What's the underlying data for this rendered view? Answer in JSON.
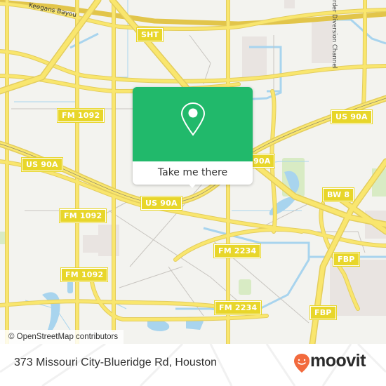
{
  "map": {
    "attribution": "© OpenStreetMap contributors",
    "labels": {
      "keegans_bayou": "Keegans Bayou",
      "diversion_channel": "rder Diversion Channel"
    },
    "shields": {
      "sht": "SHT",
      "fm1092_a": "FM 1092",
      "us90a_a": "US 90A",
      "us90a_b": "US 90A",
      "us90a_c": "US 90A",
      "us90a_d": "90A",
      "bw8": "BW 8",
      "fm1092_b": "FM 1092",
      "fm1092_c": "FM 1092",
      "fm2234_a": "FM 2234",
      "fm2234_b": "FM 2234",
      "fbp_a": "FBP",
      "fbp_b": "FBP"
    },
    "colors": {
      "background": "#f3f3ef",
      "road": "#f7e06a",
      "water": "#a8d4ee",
      "park": "#d8ebc4",
      "landuse": "#e9e4e1",
      "shield": "#e8d62a"
    }
  },
  "popup": {
    "icon": "location-pin-icon",
    "cta_label": "Take me there",
    "color": "#21b96b"
  },
  "footer": {
    "address": "373 Missouri City-Blueridge Rd, Houston",
    "brand": "moovit",
    "brand_color": "#f26a3d"
  }
}
